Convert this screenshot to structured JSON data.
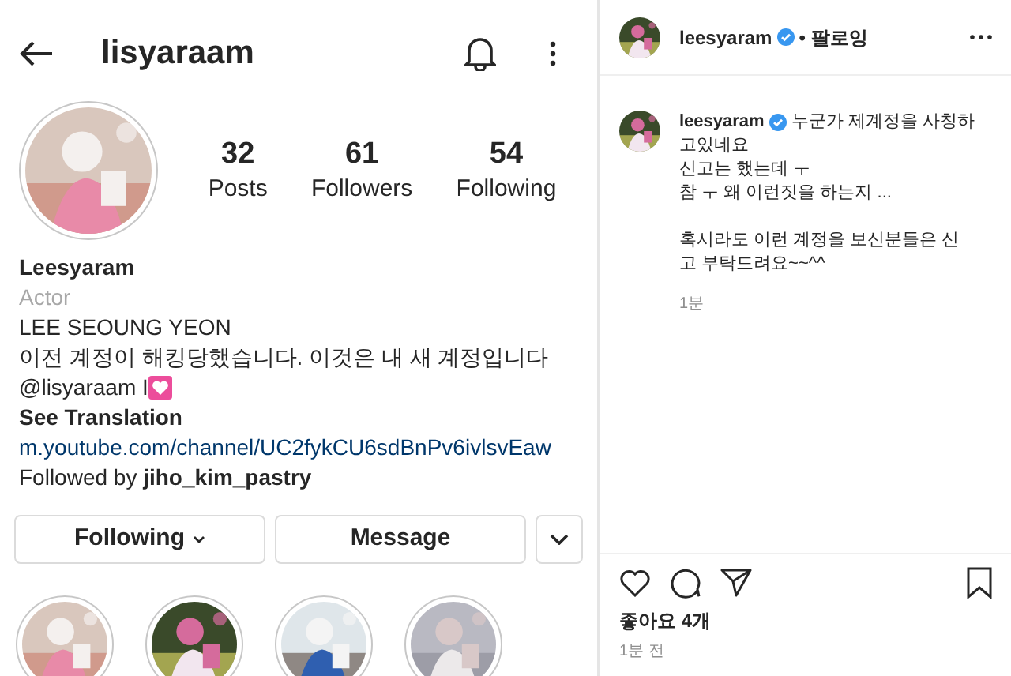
{
  "profile": {
    "username": "lisyaraam",
    "stats": [
      {
        "value": "32",
        "label": "Posts"
      },
      {
        "value": "61",
        "label": "Followers"
      },
      {
        "value": "54",
        "label": "Following"
      }
    ],
    "name": "Leesyaram",
    "category": "Actor",
    "bio_lines": [
      "LEE SEOUNG YEON",
      "이전 계정이 해킹당했습니다. 이것은 내 새 계정입니다"
    ],
    "mention": "@lisyaraam I",
    "see_translation": "See Translation",
    "link": "m.youtube.com/channel/UC2fykCU6sdBnPv6ivlsvEaw",
    "followed_by_prefix": "Followed by",
    "followed_by_user": "jiho_kim_pastry",
    "buttons": [
      {
        "label": "Following",
        "kind": "dropdown"
      },
      {
        "label": "Message",
        "kind": "plain"
      }
    ],
    "highlights": [
      {
        "kind": "picture"
      },
      {
        "kind": "picture"
      },
      {
        "kind": "picture"
      },
      {
        "kind": "picture"
      }
    ]
  },
  "post": {
    "username": "leesyaram",
    "follow_label": "• 팔로잉",
    "comment": {
      "username": "leesyaram",
      "paragraphs": [
        [
          "누군가 제계정을 사칭하",
          "고있네요",
          "신고는 했는데 ㅜ",
          "참 ㅜ 왜 이런짓을 하는지 ..."
        ],
        [
          "혹시라도 이런 계정을 보신분들은 신",
          "고 부탁드려요~~^^"
        ]
      ],
      "time": "1분"
    },
    "likes": "좋아요 4개",
    "time": "1분 전"
  }
}
